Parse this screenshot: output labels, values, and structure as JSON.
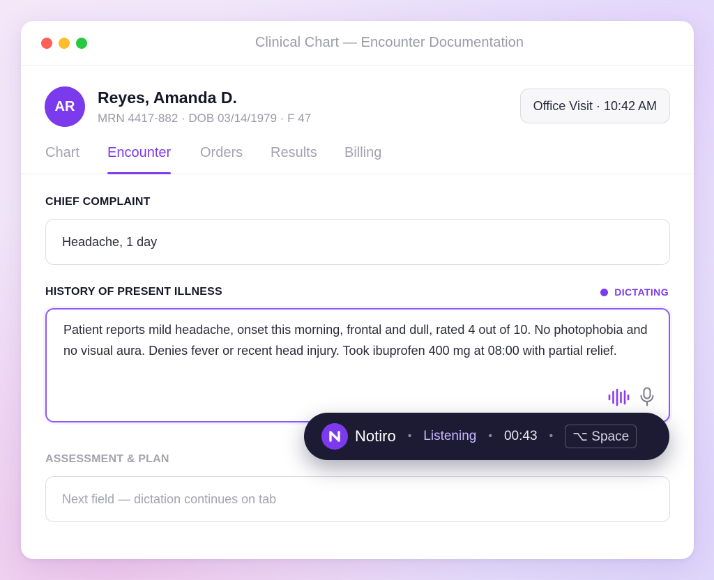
{
  "window": {
    "title": "Clinical Chart — Encounter Documentation"
  },
  "patient": {
    "initials": "AR",
    "name": "Reyes, Amanda D.",
    "meta": "MRN 4417-882 · DOB 03/14/1979 · F 47"
  },
  "visit": {
    "label": "Office Visit · 10:42 AM"
  },
  "tabs": [
    {
      "label": "Chart",
      "active": false
    },
    {
      "label": "Encounter",
      "active": true
    },
    {
      "label": "Orders",
      "active": false
    },
    {
      "label": "Results",
      "active": false
    },
    {
      "label": "Billing",
      "active": false
    }
  ],
  "chief_complaint": {
    "label": "CHIEF COMPLAINT",
    "value": "Headache, 1 day"
  },
  "hpi": {
    "label": "HISTORY OF PRESENT ILLNESS",
    "status": "DICTATING",
    "value": "Patient reports mild headache, onset this morning, frontal and dull, rated 4 out of 10. No photophobia and no visual aura. Denies fever or recent head injury. Took ibuprofen 400 mg at 08:00 with partial relief."
  },
  "assessment": {
    "label": "ASSESSMENT & PLAN",
    "placeholder": "Next field — dictation continues on tab"
  },
  "dictation_bar": {
    "brand": "Notiro",
    "status": "Listening",
    "elapsed": "00:43",
    "shortcut": "⌥ Space"
  },
  "colors": {
    "accent": "#7c3aed",
    "pill_bg": "#1d1b33"
  }
}
